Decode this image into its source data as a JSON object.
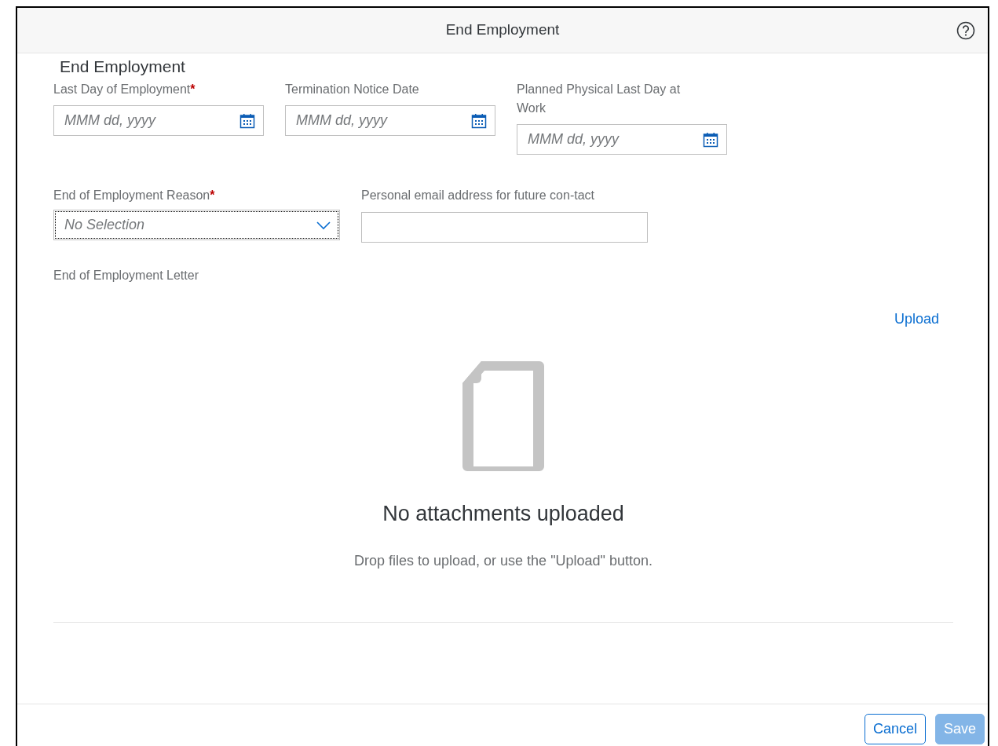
{
  "dialog": {
    "title": "End Employment"
  },
  "required_marker": "*",
  "section_title": "End Employment",
  "date_fields": [
    {
      "label": "Last Day of Employment",
      "required": true,
      "placeholder": "MMM dd, yyyy"
    },
    {
      "label": "Termination Notice Date",
      "required": false,
      "placeholder": "MMM dd, yyyy"
    },
    {
      "label": "Planned Physical Last Day at Work",
      "required": false,
      "placeholder": "MMM dd, yyyy"
    }
  ],
  "reason_field": {
    "label": "End of Employment Reason",
    "required": true,
    "value": "No Selection",
    "focused": true
  },
  "email_field": {
    "label": "Personal email address for future con-tact"
  },
  "attachments": {
    "label": "End of Employment Letter",
    "upload_link": "Upload",
    "empty_title": "No attachments uploaded",
    "empty_hint": "Drop files to upload, or use the \"Upload\" button."
  },
  "buttons": [
    {
      "label": "Cancel",
      "kind": "secondary",
      "disabled": false
    },
    {
      "label": "Save",
      "kind": "primary",
      "disabled": true
    }
  ]
}
